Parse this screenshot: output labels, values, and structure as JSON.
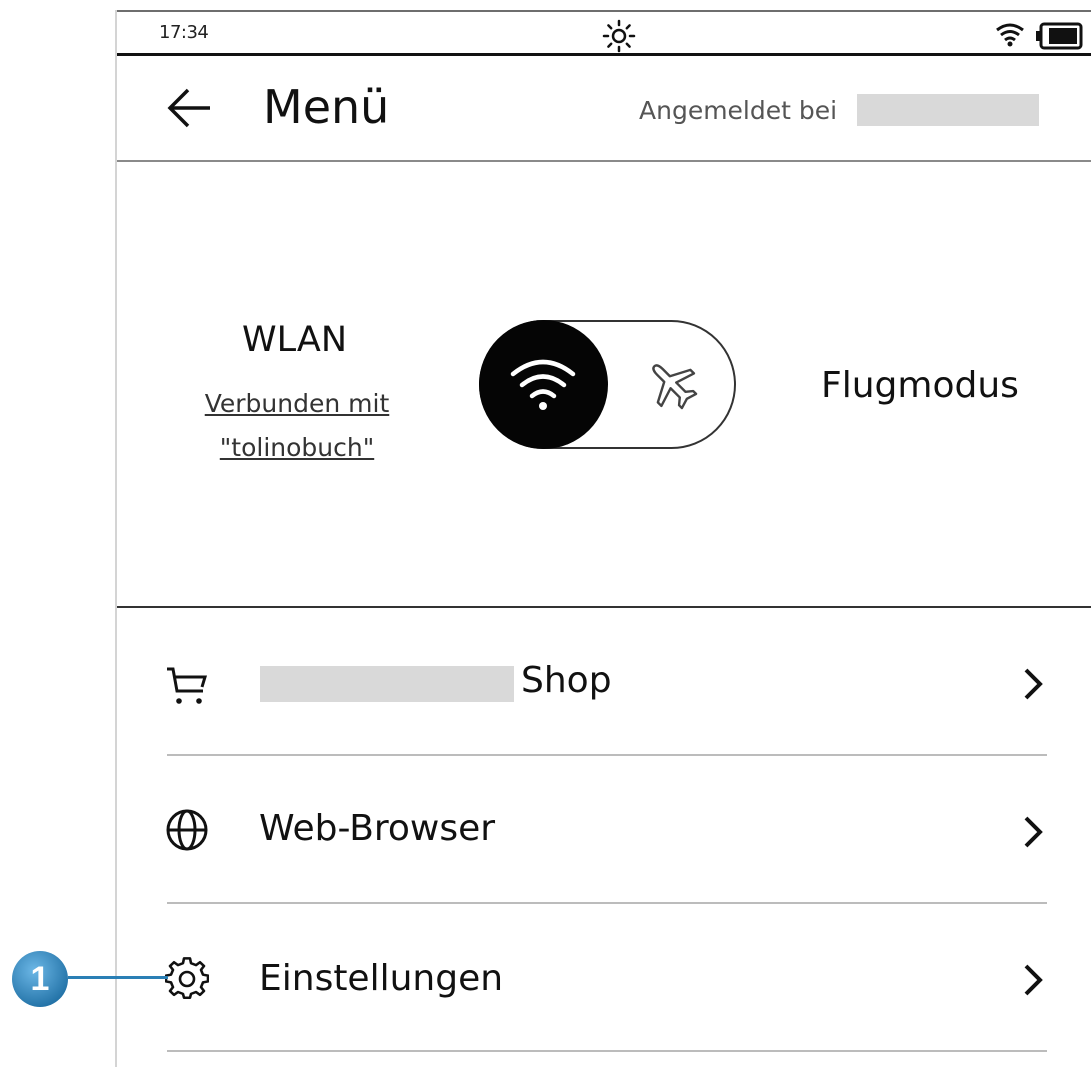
{
  "status_bar": {
    "time": "17:34",
    "icons": [
      "sun-icon",
      "wifi-icon",
      "battery-icon"
    ]
  },
  "header": {
    "back_icon": "arrow-left-icon",
    "title": "Menü",
    "login_label": "Angemeldet bei"
  },
  "connectivity": {
    "wlan_title": "WLAN",
    "wlan_status_line1": "Verbunden mit",
    "wlan_status_line2": "\"tolinobuch\"",
    "toggle_state": "wlan",
    "flight_mode_label": "Flugmodus"
  },
  "menu": {
    "items": [
      {
        "icon": "cart-icon",
        "label": "Shop"
      },
      {
        "icon": "globe-icon",
        "label": "Web-Browser"
      },
      {
        "icon": "gear-icon",
        "label": "Einstellungen"
      }
    ]
  },
  "callout": {
    "number": "1",
    "color": "#2a7fb5"
  },
  "colors": {
    "text": "#111111",
    "redacted": "#d9d9d9",
    "toggle_knob": "#050505"
  }
}
